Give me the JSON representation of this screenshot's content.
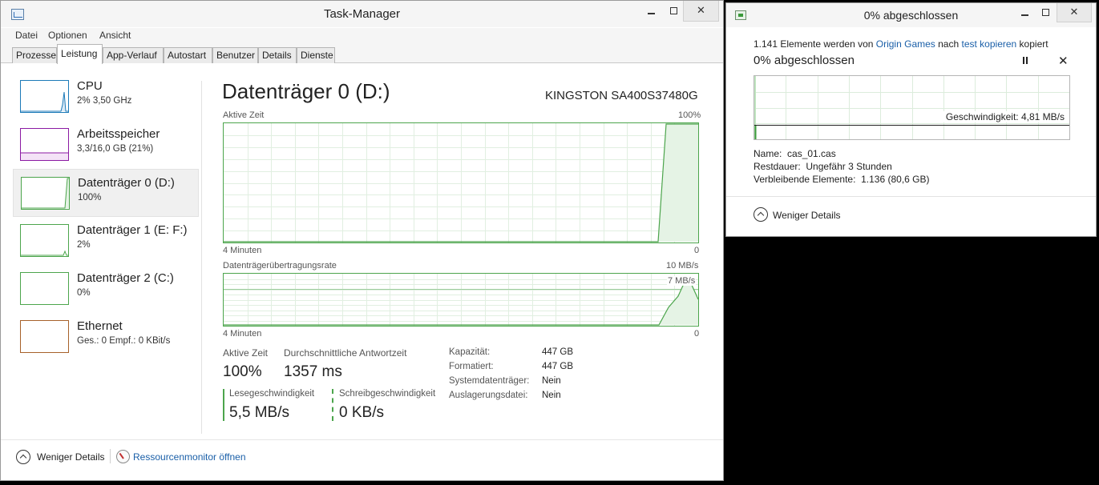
{
  "task_manager": {
    "title": "Task-Manager",
    "menu": [
      "Datei",
      "Optionen",
      "Ansicht"
    ],
    "tabs": [
      "Prozesse",
      "Leistung",
      "App-Verlauf",
      "Autostart",
      "Benutzer",
      "Details",
      "Dienste"
    ],
    "active_tab": "Leistung",
    "sidebar": [
      {
        "name": "CPU",
        "sub": "2% 3,50 GHz",
        "color": "#1c7ab8"
      },
      {
        "name": "Arbeitsspeicher",
        "sub": "3,3/16,0 GB (21%)",
        "color": "#8b1aa3"
      },
      {
        "name": "Datenträger 0 (D:)",
        "sub": "100%",
        "color": "#4ca54c"
      },
      {
        "name": "Datenträger 1 (E: F:)",
        "sub": "2%",
        "color": "#4ca54c"
      },
      {
        "name": "Datenträger 2 (C:)",
        "sub": "0%",
        "color": "#4ca54c"
      },
      {
        "name": "Ethernet",
        "sub": "Ges.: 0 Empf.: 0 KBit/s",
        "color": "#a7612a"
      }
    ],
    "selected_sidebar": 2,
    "main": {
      "title": "Datenträger 0 (D:)",
      "model": "KINGSTON SA400S37480G",
      "graph1": {
        "label": "Aktive Zeit",
        "max": "100%",
        "time": "4 Minuten",
        "zero": "0"
      },
      "graph2": {
        "label": "Datenträgerübertragungsrate",
        "max": "10 MB/s",
        "marker": "7 MB/s",
        "time": "4 Minuten",
        "zero": "0"
      },
      "stats": {
        "active_time_label": "Aktive Zeit",
        "active_time_value": "100%",
        "response_label": "Durchschnittliche Antwortzeit",
        "response_value": "1357 ms",
        "read_label": "Lesegeschwindigkeit",
        "read_value": "5,5 MB/s",
        "write_label": "Schreibgeschwindigkeit",
        "write_value": "0 KB/s"
      },
      "properties": [
        {
          "label": "Kapazität:",
          "value": "447 GB"
        },
        {
          "label": "Formatiert:",
          "value": "447 GB"
        },
        {
          "label": "Systemdatenträger:",
          "value": "Nein"
        },
        {
          "label": "Auslagerungsdatei:",
          "value": "Nein"
        }
      ]
    },
    "footer": {
      "fewer_details": "Weniger Details",
      "resource_monitor": "Ressourcenmonitor öffnen"
    }
  },
  "copy_dialog": {
    "title": "0% abgeschlossen",
    "line_prefix": "1.141 Elemente werden von ",
    "source": "Origin Games",
    "line_mid": " nach ",
    "destination": "test kopieren",
    "line_suffix": " kopiert",
    "progress_title": "0% abgeschlossen",
    "speed": "Geschwindigkeit: 4,81 MB/s",
    "progress_fraction": 0.0,
    "name_label": "Name:",
    "name_value": "cas_01.cas",
    "remaining_time_label": "Restdauer:",
    "remaining_time_value": "Ungefähr 3 Stunden",
    "remaining_items_label": "Verbleibende Elemente:",
    "remaining_items_value": "1.136 (80,6 GB)",
    "fewer_details": "Weniger Details"
  }
}
